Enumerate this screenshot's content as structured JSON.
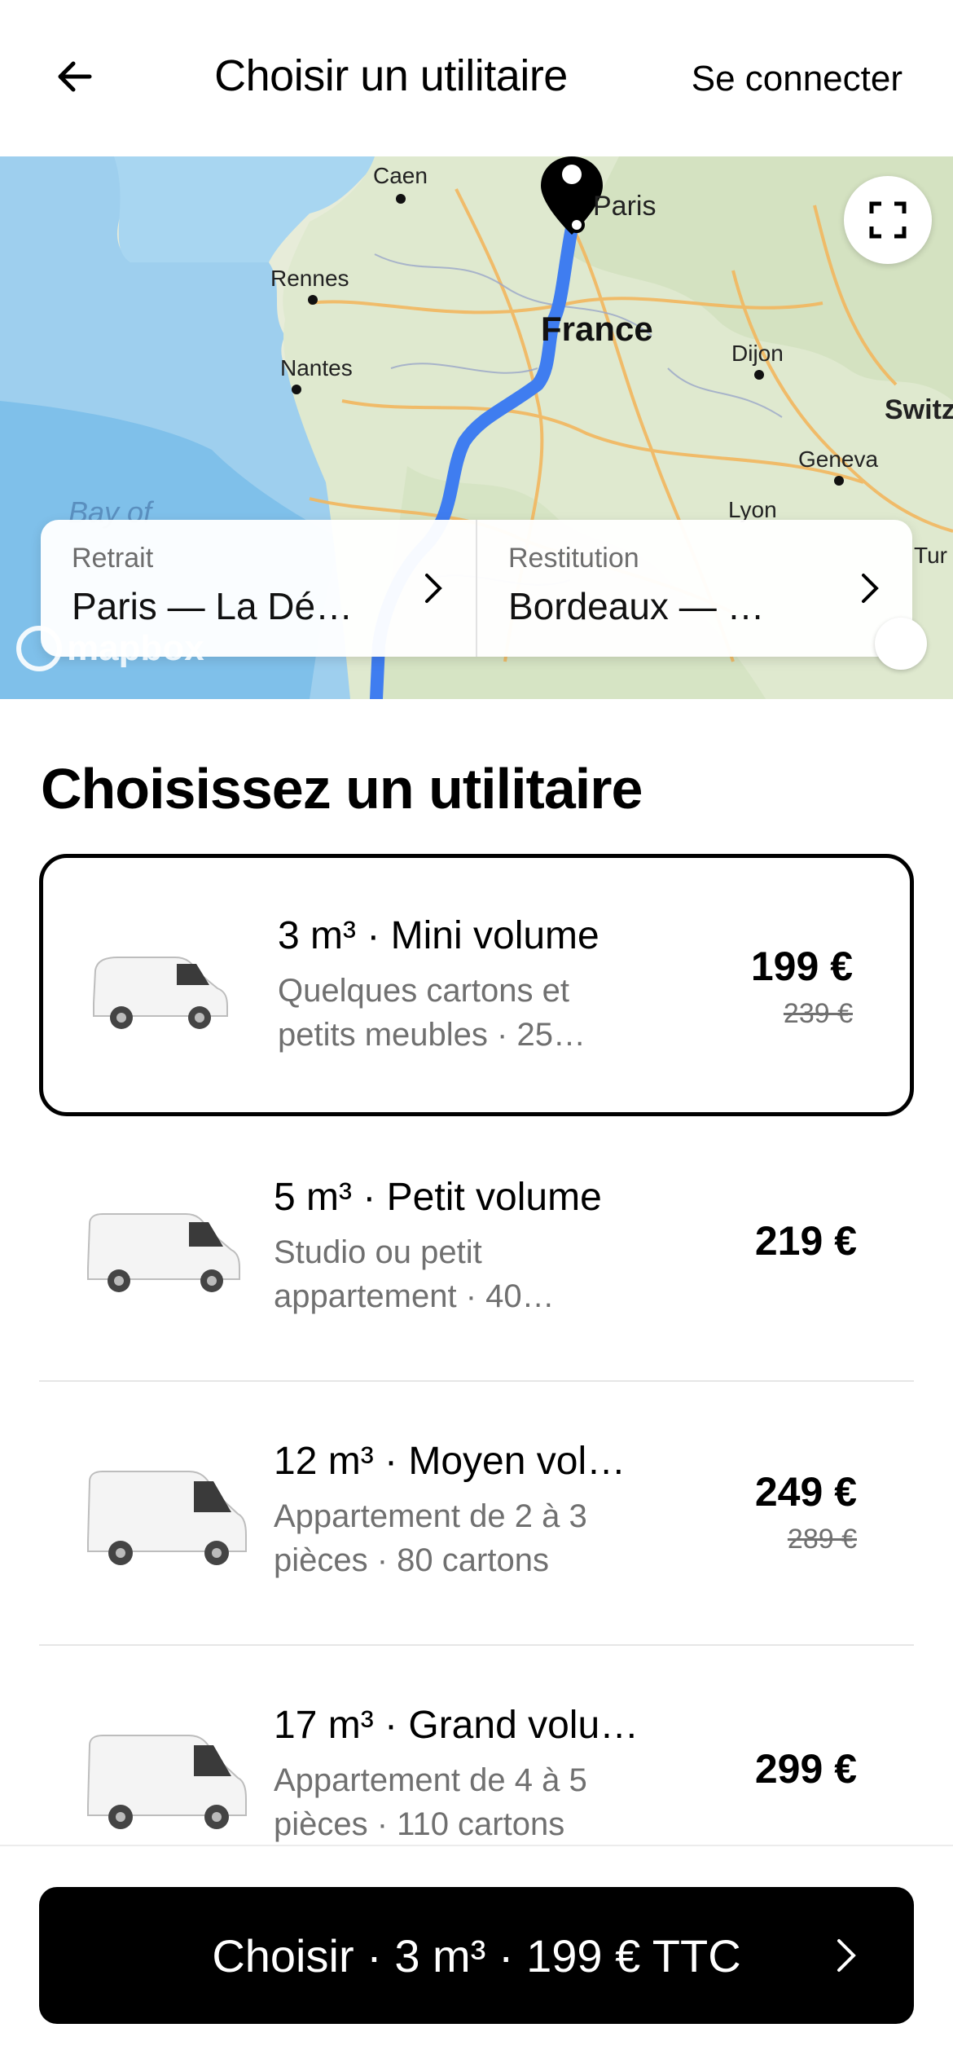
{
  "header": {
    "title": "Choisir un utilitaire",
    "login_label": "Se connecter"
  },
  "map": {
    "labels": {
      "caen": "Caen",
      "paris": "Paris",
      "rennes": "Rennes",
      "france": "France",
      "dijon": "Dijon",
      "nantes": "Nantes",
      "switz": "Switz",
      "geneva": "Geneva",
      "lyon": "Lyon",
      "bay": "Bay of",
      "turin": "Tur"
    },
    "attribution": "mapbox",
    "route_color": "#3f7df0"
  },
  "locations": {
    "pickup": {
      "label": "Retrait",
      "value": "Paris — La Dé…"
    },
    "return": {
      "label": "Restitution",
      "value": "Bordeaux — …"
    }
  },
  "section_title": "Choisissez un utilitaire",
  "vehicles": [
    {
      "name": "3 m³ · Mini volume",
      "desc": "Quelques cartons et petits meubles · 25…",
      "price": "199 €",
      "old_price": "239 €",
      "selected": true
    },
    {
      "name": "5 m³ · Petit volume",
      "desc": "Studio ou petit appartement · 40…",
      "price": "219 €",
      "old_price": ""
    },
    {
      "name": "12 m³ · Moyen vol…",
      "desc": "Appartement de 2 à 3 pièces · 80 cartons",
      "price": "249 €",
      "old_price": "289 €"
    },
    {
      "name": "17 m³ · Grand volu…",
      "desc": "Appartement de 4 à 5 pièces · 110 cartons",
      "price": "299 €",
      "old_price": ""
    }
  ],
  "cta": {
    "label": "Choisir · 3 m³ · 199 € TTC"
  },
  "colors": {
    "primary": "#000000",
    "muted_text": "#707070",
    "selected_border": "#000000"
  }
}
